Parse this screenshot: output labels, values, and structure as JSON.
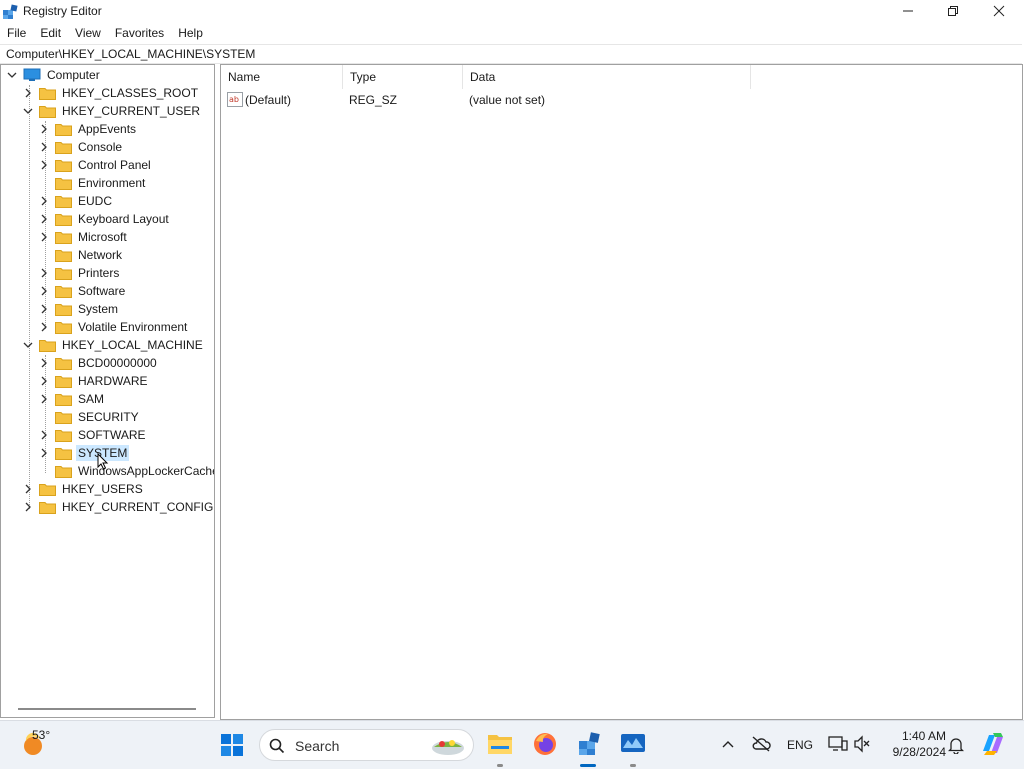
{
  "window": {
    "title": "Registry Editor"
  },
  "menu": [
    "File",
    "Edit",
    "View",
    "Favorites",
    "Help"
  ],
  "address": "Computer\\HKEY_LOCAL_MACHINE\\SYSTEM",
  "tree": {
    "root": "Computer",
    "hkcr": "HKEY_CLASSES_ROOT",
    "hkcu": "HKEY_CURRENT_USER",
    "hkcu_children": [
      "AppEvents",
      "Console",
      "Control Panel",
      "Environment",
      "EUDC",
      "Keyboard Layout",
      "Microsoft",
      "Network",
      "Printers",
      "Software",
      "System",
      "Volatile Environment"
    ],
    "hklm": "HKEY_LOCAL_MACHINE",
    "hklm_children": [
      "BCD00000000",
      "HARDWARE",
      "SAM",
      "SECURITY",
      "SOFTWARE",
      "SYSTEM",
      "WindowsAppLockerCache"
    ],
    "selected": "SYSTEM",
    "hku": "HKEY_USERS",
    "hkcc": "HKEY_CURRENT_CONFIG"
  },
  "list": {
    "columns": [
      "Name",
      "Type",
      "Data"
    ],
    "rows": [
      {
        "name": "(Default)",
        "type": "REG_SZ",
        "data": "(value not set)"
      }
    ]
  },
  "taskbar": {
    "weather_temp": "53°",
    "search_placeholder": "Search",
    "language": "ENG",
    "time": "1:40 AM",
    "date": "9/28/2024"
  },
  "colors": {
    "accent": "#0067c0",
    "selection": "#cce8ff",
    "folder": "#f5c242"
  }
}
